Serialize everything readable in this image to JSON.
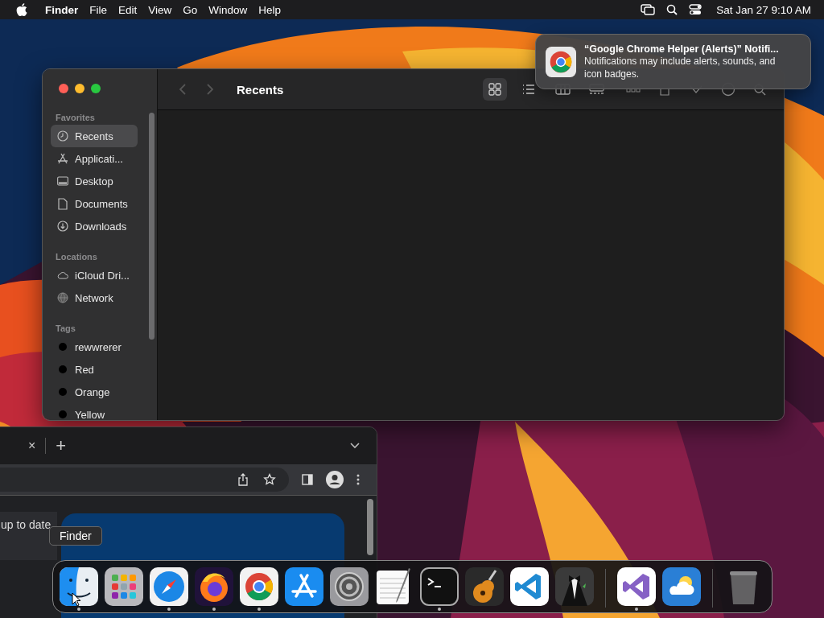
{
  "menu_bar": {
    "items": [
      "Finder",
      "File",
      "Edit",
      "View",
      "Go",
      "Window",
      "Help"
    ],
    "clock": "Sat Jan 27  9:10 AM"
  },
  "finder": {
    "title": "Recents",
    "nav": [
      {
        "kind": "back",
        "disabled": true
      },
      {
        "kind": "forward",
        "disabled": true
      }
    ],
    "views": [
      {
        "kind": "icons",
        "selected": true
      },
      {
        "kind": "list",
        "selected": false
      },
      {
        "kind": "columns",
        "selected": false
      },
      {
        "kind": "gallery",
        "selected": false
      }
    ],
    "sidebar": [
      {
        "heading": "Favorites",
        "items": [
          {
            "label": "Recents",
            "kind": "clock",
            "selected": true
          },
          {
            "label": "Applicati...",
            "kind": "apps",
            "selected": false
          },
          {
            "label": "Desktop",
            "kind": "desktop",
            "selected": false
          },
          {
            "label": "Documents",
            "kind": "document",
            "selected": false
          },
          {
            "label": "Downloads",
            "kind": "download",
            "selected": false
          }
        ]
      },
      {
        "heading": "Locations",
        "items": [
          {
            "label": "iCloud Dri...",
            "kind": "cloud",
            "selected": false
          },
          {
            "label": "Network",
            "kind": "network",
            "selected": false
          }
        ]
      },
      {
        "heading": "Tags",
        "items": [
          {
            "label": "rewwrerer",
            "kind": "tag",
            "selected": false
          },
          {
            "label": "Red",
            "kind": "tag",
            "selected": false
          },
          {
            "label": "Orange",
            "kind": "tag",
            "selected": false
          },
          {
            "label": "Yellow",
            "kind": "tag",
            "selected": false
          }
        ]
      }
    ]
  },
  "notification": {
    "title": "“Google Chrome Helper (Alerts)” Notifi...",
    "body": "Notifications may include alerts, sounds, and icon badges."
  },
  "browser": {
    "tab_close": "×",
    "new_tab": "+",
    "page_text": "up to date"
  },
  "tooltip": "Finder",
  "dock": [
    {
      "kind": "finder",
      "running": true
    },
    {
      "kind": "launchpad",
      "running": false
    },
    {
      "kind": "safari",
      "running": true
    },
    {
      "kind": "firefox",
      "running": true
    },
    {
      "kind": "chrome",
      "running": true
    },
    {
      "kind": "appstore",
      "running": false
    },
    {
      "kind": "settings",
      "running": false
    },
    {
      "kind": "textedit",
      "running": false
    },
    {
      "kind": "terminal",
      "running": true
    },
    {
      "kind": "garageband",
      "running": false
    },
    {
      "kind": "vscode",
      "running": false
    },
    {
      "kind": "tuxedo",
      "running": false
    },
    {
      "kind": "separator"
    },
    {
      "kind": "visualstudio",
      "running": true
    },
    {
      "kind": "weather",
      "running": false
    },
    {
      "kind": "separator"
    },
    {
      "kind": "trash",
      "running": false
    }
  ]
}
